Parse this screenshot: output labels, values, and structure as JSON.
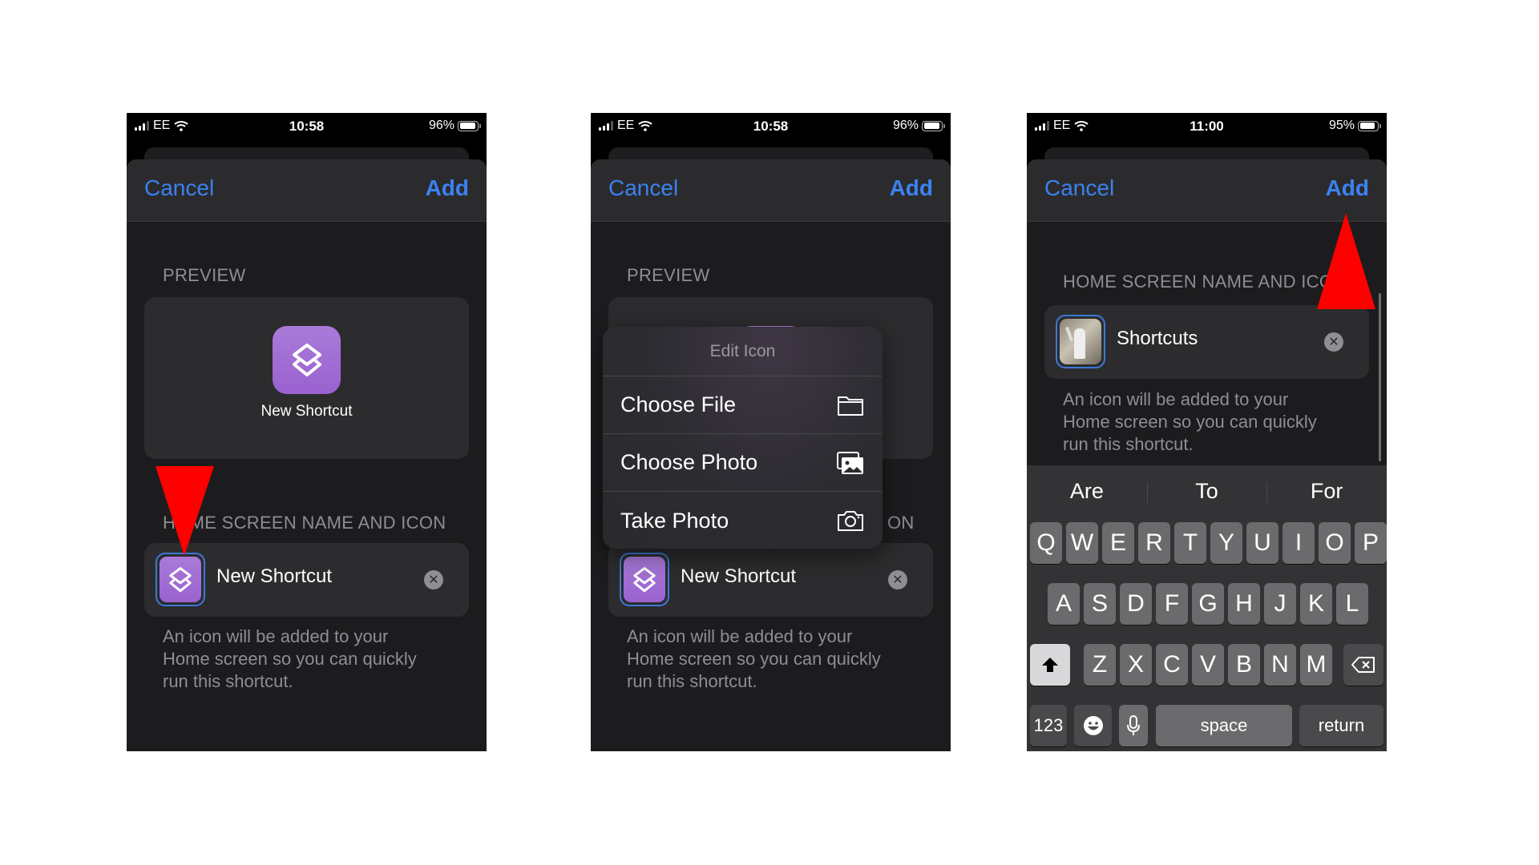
{
  "phones": [
    {
      "status": {
        "carrier": "EE",
        "time": "10:58",
        "battery": "96%"
      },
      "nav": {
        "cancel": "Cancel",
        "add": "Add"
      },
      "preview_label": "PREVIEW",
      "preview_name": "New Shortcut",
      "section_label": "HOME SCREEN NAME AND ICON",
      "row_name": "New Shortcut",
      "description": [
        "An icon will be added to your",
        "Home screen so you can quickly",
        "run this shortcut."
      ]
    },
    {
      "status": {
        "carrier": "EE",
        "time": "10:58",
        "battery": "96%"
      },
      "nav": {
        "cancel": "Cancel",
        "add": "Add"
      },
      "preview_label": "PREVIEW",
      "section_label_tail": "ON",
      "row_name": "New Shortcut",
      "description": [
        "An icon will be added to your",
        "Home screen so you can quickly",
        "run this shortcut."
      ],
      "menu": {
        "title": "Edit Icon",
        "items": [
          {
            "label": "Choose File",
            "icon": "folder-icon"
          },
          {
            "label": "Choose Photo",
            "icon": "photo-library-icon"
          },
          {
            "label": "Take Photo",
            "icon": "camera-icon"
          }
        ]
      }
    },
    {
      "status": {
        "carrier": "EE",
        "time": "11:00",
        "battery": "95%"
      },
      "nav": {
        "cancel": "Cancel",
        "add": "Add"
      },
      "section_label": "HOME SCREEN NAME AND ICON",
      "row_name": "Shortcuts",
      "description": [
        "An icon will be added to your",
        "Home screen so you can quickly",
        "run this shortcut."
      ],
      "keyboard": {
        "suggestions": [
          "Are",
          "To",
          "For"
        ],
        "row1": [
          "Q",
          "W",
          "E",
          "R",
          "T",
          "Y",
          "U",
          "I",
          "O",
          "P"
        ],
        "row2": [
          "A",
          "S",
          "D",
          "F",
          "G",
          "H",
          "J",
          "K",
          "L"
        ],
        "row3": [
          "Z",
          "X",
          "C",
          "V",
          "B",
          "N",
          "M"
        ],
        "numbers_key": "123",
        "space_key": "space",
        "return_key": "return"
      }
    }
  ],
  "colors": {
    "accent": "#3b82f0",
    "annotation_arrow": "#ff0000",
    "icon_purple": "#a073d6"
  }
}
